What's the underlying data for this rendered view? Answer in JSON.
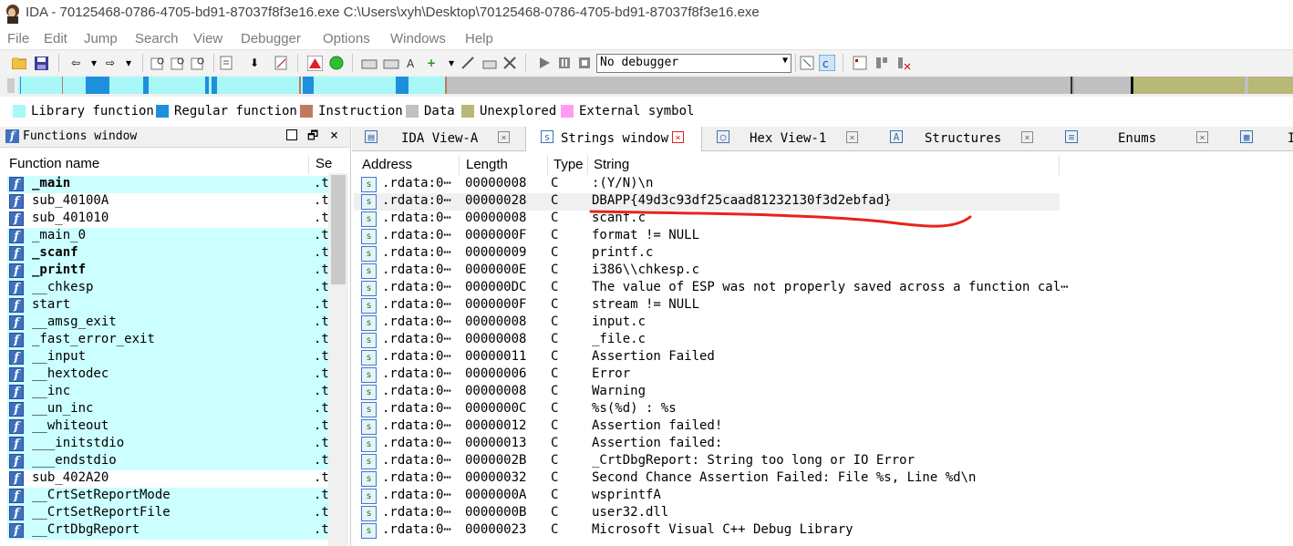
{
  "window": {
    "title": "IDA - 70125468-0786-4705-bd91-87037f8f3e16.exe C:\\Users\\xyh\\Desktop\\70125468-0786-4705-bd91-87037f8f3e16.exe"
  },
  "menu": [
    "File",
    "Edit",
    "Jump",
    "Search",
    "View",
    "Debugger",
    "Options",
    "Windows",
    "Help"
  ],
  "toolbar": {
    "debugger_select": "No debugger"
  },
  "legend": [
    {
      "label": "Library function",
      "color": "#a8f8f8"
    },
    {
      "label": "Regular function",
      "color": "#1d8fdd"
    },
    {
      "label": "Instruction",
      "color": "#c07a5e"
    },
    {
      "label": "Data",
      "color": "#c0c0c0"
    },
    {
      "label": "Unexplored",
      "color": "#b8b878"
    },
    {
      "label": "External symbol",
      "color": "#ff9cf0"
    }
  ],
  "functions_window": {
    "title": "Functions window",
    "col_name": "Function name",
    "col_segment": "Se",
    "items": [
      {
        "name": "_main",
        "seg": ".t"
      },
      {
        "name": "sub_40100A",
        "seg": ".t"
      },
      {
        "name": "sub_401010",
        "seg": ".t"
      },
      {
        "name": "_main_0",
        "seg": ".t"
      },
      {
        "name": "_scanf",
        "seg": ".t"
      },
      {
        "name": "_printf",
        "seg": ".t"
      },
      {
        "name": "__chkesp",
        "seg": ".t"
      },
      {
        "name": "start",
        "seg": ".t"
      },
      {
        "name": "__amsg_exit",
        "seg": ".t"
      },
      {
        "name": "_fast_error_exit",
        "seg": ".t"
      },
      {
        "name": "__input",
        "seg": ".t"
      },
      {
        "name": "__hextodec",
        "seg": ".t"
      },
      {
        "name": "__inc",
        "seg": ".t"
      },
      {
        "name": "__un_inc",
        "seg": ".t"
      },
      {
        "name": "__whiteout",
        "seg": ".t"
      },
      {
        "name": "___initstdio",
        "seg": ".t"
      },
      {
        "name": "___endstdio",
        "seg": ".t"
      },
      {
        "name": "sub_402A20",
        "seg": ".t"
      },
      {
        "name": "__CrtSetReportMode",
        "seg": ".t"
      },
      {
        "name": "__CrtSetReportFile",
        "seg": ".t"
      },
      {
        "name": "__CrtDbgReport",
        "seg": ".t"
      }
    ]
  },
  "tabs": [
    {
      "label": "IDA View-A"
    },
    {
      "label": "Strings window"
    },
    {
      "label": "Hex View-1"
    },
    {
      "label": "Structures"
    },
    {
      "label": "Enums"
    },
    {
      "label": "I"
    }
  ],
  "strings_window": {
    "columns": [
      "Address",
      "Length",
      "Type",
      "String"
    ],
    "rows": [
      {
        "address": ".rdata:0⋯",
        "length": "00000008",
        "type": "C",
        "string": ":(Y/N)\\n"
      },
      {
        "address": ".rdata:0⋯",
        "length": "00000028",
        "type": "C",
        "string": "DBAPP{49d3c93df25caad81232130f3d2ebfad}"
      },
      {
        "address": ".rdata:0⋯",
        "length": "00000008",
        "type": "C",
        "string": "scanf.c"
      },
      {
        "address": ".rdata:0⋯",
        "length": "0000000F",
        "type": "C",
        "string": "format != NULL"
      },
      {
        "address": ".rdata:0⋯",
        "length": "00000009",
        "type": "C",
        "string": "printf.c"
      },
      {
        "address": ".rdata:0⋯",
        "length": "0000000E",
        "type": "C",
        "string": "i386\\\\chkesp.c"
      },
      {
        "address": ".rdata:0⋯",
        "length": "000000DC",
        "type": "C",
        "string": "The value of ESP was not properly saved across a function cal⋯"
      },
      {
        "address": ".rdata:0⋯",
        "length": "0000000F",
        "type": "C",
        "string": "stream != NULL"
      },
      {
        "address": ".rdata:0⋯",
        "length": "00000008",
        "type": "C",
        "string": "input.c"
      },
      {
        "address": ".rdata:0⋯",
        "length": "00000008",
        "type": "C",
        "string": "_file.c"
      },
      {
        "address": ".rdata:0⋯",
        "length": "00000011",
        "type": "C",
        "string": "Assertion Failed"
      },
      {
        "address": ".rdata:0⋯",
        "length": "00000006",
        "type": "C",
        "string": "Error"
      },
      {
        "address": ".rdata:0⋯",
        "length": "00000008",
        "type": "C",
        "string": "Warning"
      },
      {
        "address": ".rdata:0⋯",
        "length": "0000000C",
        "type": "C",
        "string": "%s(%d) : %s"
      },
      {
        "address": ".rdata:0⋯",
        "length": "00000012",
        "type": "C",
        "string": "Assertion failed!"
      },
      {
        "address": ".rdata:0⋯",
        "length": "00000013",
        "type": "C",
        "string": "Assertion failed:"
      },
      {
        "address": ".rdata:0⋯",
        "length": "0000002B",
        "type": "C",
        "string": "_CrtDbgReport: String too long or IO Error"
      },
      {
        "address": ".rdata:0⋯",
        "length": "00000032",
        "type": "C",
        "string": "Second Chance Assertion Failed: File %s, Line %d\\n"
      },
      {
        "address": ".rdata:0⋯",
        "length": "0000000A",
        "type": "C",
        "string": "wsprintfA"
      },
      {
        "address": ".rdata:0⋯",
        "length": "0000000B",
        "type": "C",
        "string": "user32.dll"
      },
      {
        "address": ".rdata:0⋯",
        "length": "00000023",
        "type": "C",
        "string": "Microsoft Visual C++ Debug Library"
      }
    ]
  }
}
